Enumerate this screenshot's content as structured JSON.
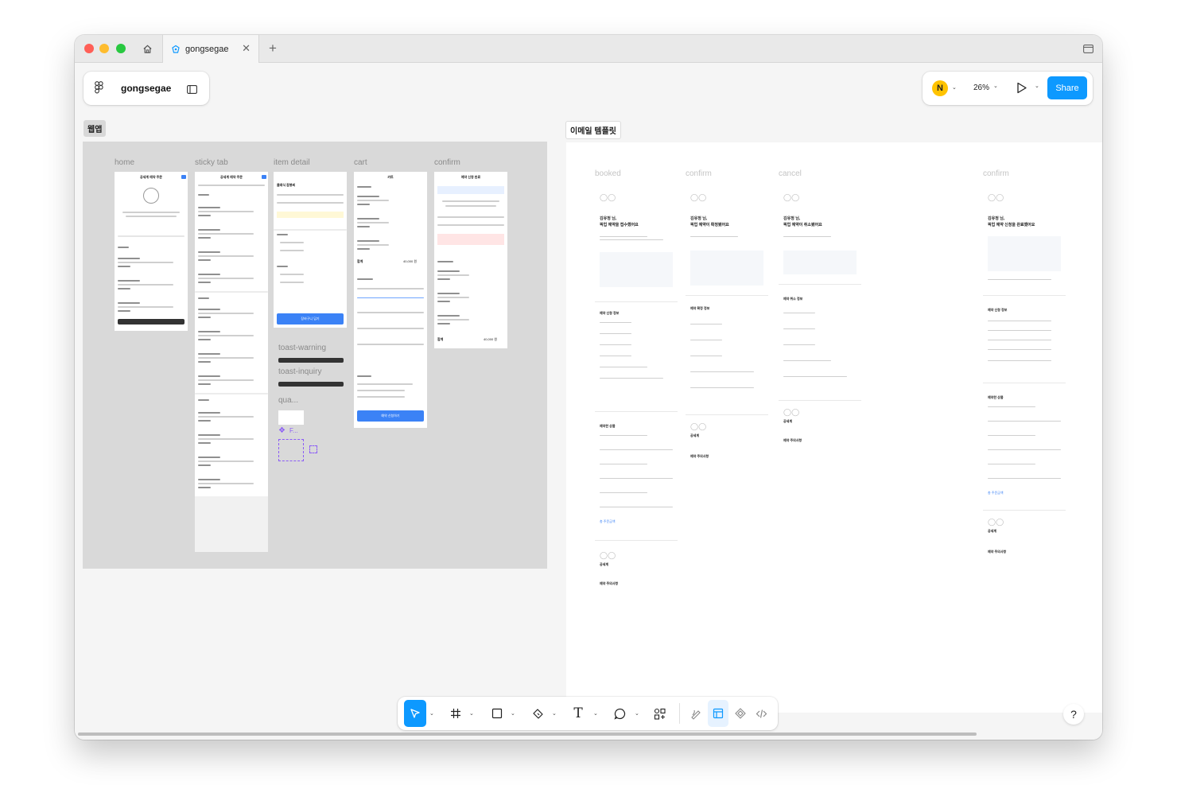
{
  "window": {
    "tab_title": "gongsegae",
    "colors": {
      "traffic_red": "#ff5f57",
      "traffic_yellow": "#febc2e",
      "traffic_green": "#28c840",
      "accent": "#0d99ff"
    }
  },
  "file_panel": {
    "title": "gongsegae"
  },
  "right_panel": {
    "avatar_initial": "N",
    "zoom": "26%",
    "share_label": "Share"
  },
  "sections": {
    "webapp": "웹앱",
    "email": "이메일 템플릿"
  },
  "frames": {
    "home": "home",
    "sticky_tab": "sticky tab",
    "item_detail": "item detail",
    "cart": "cart",
    "confirm": "confirm",
    "toast_warning": "toast-warning",
    "toast_inquiry": "toast-inquiry",
    "qua": "qua...",
    "f_component": "F..."
  },
  "email_frames": {
    "booked": "booked",
    "confirm": "confirm",
    "cancel": "cancel",
    "confirm2": "confirm"
  },
  "phone_text": {
    "home_title": "공세계 예약 주문",
    "sticky_title": "공세계 예약 주문",
    "detail_title": "클래식 잠봉뵈",
    "cart_title": "카트",
    "confirm_title": "예약 신청 완료",
    "detail_button": "장바구니 담기",
    "cart_button": "예약 신청하기",
    "total_label": "합계",
    "total_value": "40,000 원"
  },
  "emails": {
    "booked": {
      "greeting": "김유정 님,",
      "headline": "픽업 예약을 접수했어요",
      "info": "예약 신청 정보",
      "products": "예약한 상품",
      "notice": "예약 주의사항",
      "brand": "공세계",
      "total": "총 주문금액"
    },
    "confirm": {
      "greeting": "김유정 님,",
      "headline": "픽업 예약이 확정됐어요",
      "info": "예약 확정 정보",
      "notice": "예약 주의사항",
      "brand": "공세계"
    },
    "cancel": {
      "greeting": "김유정 님,",
      "headline": "픽업 예약이 취소됐어요",
      "info": "예약 취소 정보",
      "notice": "예약 주의사항",
      "brand": "공세계"
    },
    "confirm2": {
      "greeting": "김유정 님,",
      "headline": "픽업 예약 신청을 완료했어요",
      "info": "예약 신청 정보",
      "products": "예약한 상품",
      "notice": "예약 주의사항",
      "brand": "공세계",
      "total": "총 주문금액"
    }
  },
  "icons": {
    "home": "home-icon",
    "tab_logo": "figma-slides-icon",
    "close": "close-icon",
    "add": "plus-icon",
    "sidebar": "sidebar-toggle-icon",
    "figma": "figma-logo-icon",
    "play": "play-icon",
    "help": "question-icon",
    "move": "cursor-arrow-icon",
    "frame": "frame-hash-icon",
    "shape": "rectangle-icon",
    "pen": "pen-icon",
    "text": "text-icon",
    "comment": "comment-icon",
    "actions": "actions-icon",
    "draw": "draw-icon",
    "design": "design-mode-icon",
    "component": "component-icon",
    "dev": "dev-mode-icon"
  },
  "help_label": "?"
}
